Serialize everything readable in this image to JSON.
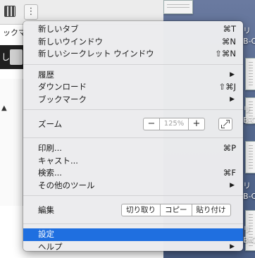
{
  "browser": {
    "bookmark_bar_text": "ックマ",
    "dark_strip_text": "し",
    "up_arrow": "▲",
    "menu_button": "⋮"
  },
  "desktop": {
    "side_labels": [
      "リ\nB-C",
      "リ\nB-C",
      "リ\nB-C",
      "リ\nB-C"
    ]
  },
  "menu": {
    "group1": [
      {
        "label": "新しいタブ",
        "shortcut": "⌘T"
      },
      {
        "label": "新しいウインドウ",
        "shortcut": "⌘N"
      },
      {
        "label": "新しいシークレット ウインドウ",
        "shortcut": "⇧⌘N"
      }
    ],
    "group2": [
      {
        "label": "履歴",
        "arrow": "▶"
      },
      {
        "label": "ダウンロード",
        "shortcut": "⇧⌘J"
      },
      {
        "label": "ブックマーク",
        "arrow": "▶"
      }
    ],
    "zoom": {
      "label": "ズーム",
      "minus": "−",
      "value": "125%",
      "plus": "+"
    },
    "group3": [
      {
        "label": "印刷...",
        "shortcut": "⌘P"
      },
      {
        "label": "キャスト..."
      },
      {
        "label": "検索...",
        "shortcut": "⌘F"
      },
      {
        "label": "その他のツール",
        "arrow": "▶"
      }
    ],
    "edit": {
      "label": "編集",
      "cut": "切り取り",
      "copy": "コピー",
      "paste": "貼り付け"
    },
    "group4": [
      {
        "label": "設定"
      },
      {
        "label": "ヘルプ",
        "arrow": "▶"
      }
    ],
    "highlight_color": "#1f6fe0"
  }
}
